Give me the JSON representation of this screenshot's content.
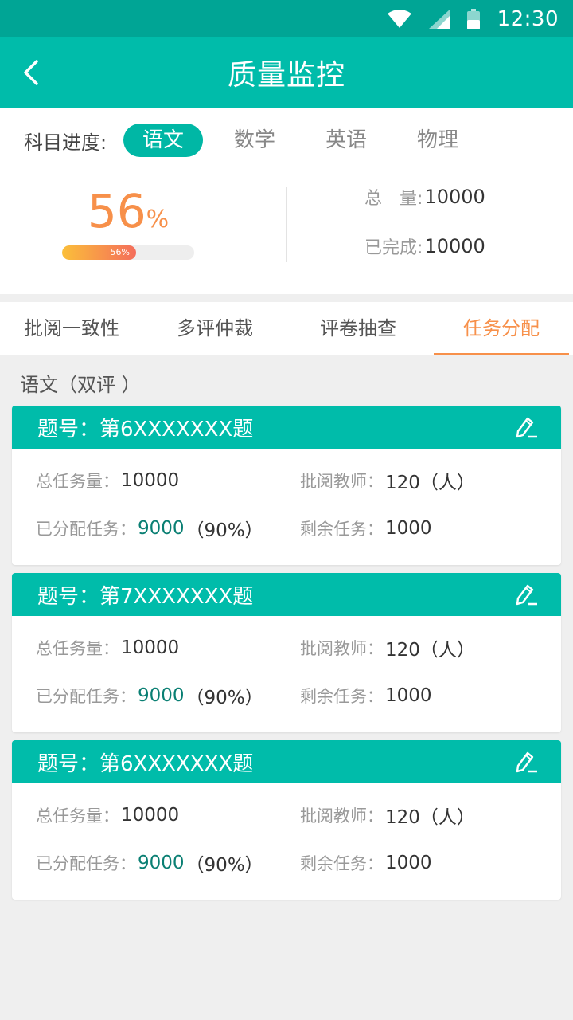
{
  "status_bar": {
    "time": "12:30",
    "icons": [
      "wifi-icon",
      "signal-icon",
      "battery-icon"
    ]
  },
  "header": {
    "title": "质量监控",
    "back_icon": "chevron-left-icon"
  },
  "subject": {
    "label": "科目进度:",
    "tabs": [
      {
        "label": "语文",
        "active": true
      },
      {
        "label": "数学",
        "active": false
      },
      {
        "label": "英语",
        "active": false
      },
      {
        "label": "物理",
        "active": false
      }
    ],
    "progress": {
      "value_number": "56",
      "value_unit": "%",
      "bar_label": "56%",
      "fraction": 0.56
    },
    "stats": {
      "total_label": "总　量:",
      "total_value": "10000",
      "done_label": "已完成:",
      "done_value": "10000"
    }
  },
  "tabs": [
    {
      "label": "批阅一致性",
      "active": false
    },
    {
      "label": "多评仲裁",
      "active": false
    },
    {
      "label": "评卷抽查",
      "active": false
    },
    {
      "label": "任务分配",
      "active": true
    }
  ],
  "section_label": "语文（双评 ）",
  "cards": [
    {
      "title": "题号：第6XXXXXXX题",
      "total_label": "总任务量：",
      "total_value": "10000",
      "teachers_label": "批阅教师：",
      "teachers_value": "120（人）",
      "assigned_label": "已分配任务：",
      "assigned_value": "9000",
      "assigned_pct": "（90%）",
      "remaining_label": "剩余任务：",
      "remaining_value": "1000"
    },
    {
      "title": "题号：第7XXXXXXX题",
      "total_label": "总任务量：",
      "total_value": "10000",
      "teachers_label": "批阅教师：",
      "teachers_value": "120（人）",
      "assigned_label": "已分配任务：",
      "assigned_value": "9000",
      "assigned_pct": "（90%）",
      "remaining_label": "剩余任务：",
      "remaining_value": "1000"
    },
    {
      "title": "题号：第6XXXXXXX题",
      "total_label": "总任务量：",
      "total_value": "10000",
      "teachers_label": "批阅教师：",
      "teachers_value": "120（人）",
      "assigned_label": "已分配任务：",
      "assigned_value": "9000",
      "assigned_pct": "（90%）",
      "remaining_label": "剩余任务：",
      "remaining_value": "1000"
    }
  ],
  "colors": {
    "primary": "#00bcaa",
    "status_bar": "#00a595",
    "accent": "#f7904a",
    "assigned_value": "#0a7f73"
  }
}
